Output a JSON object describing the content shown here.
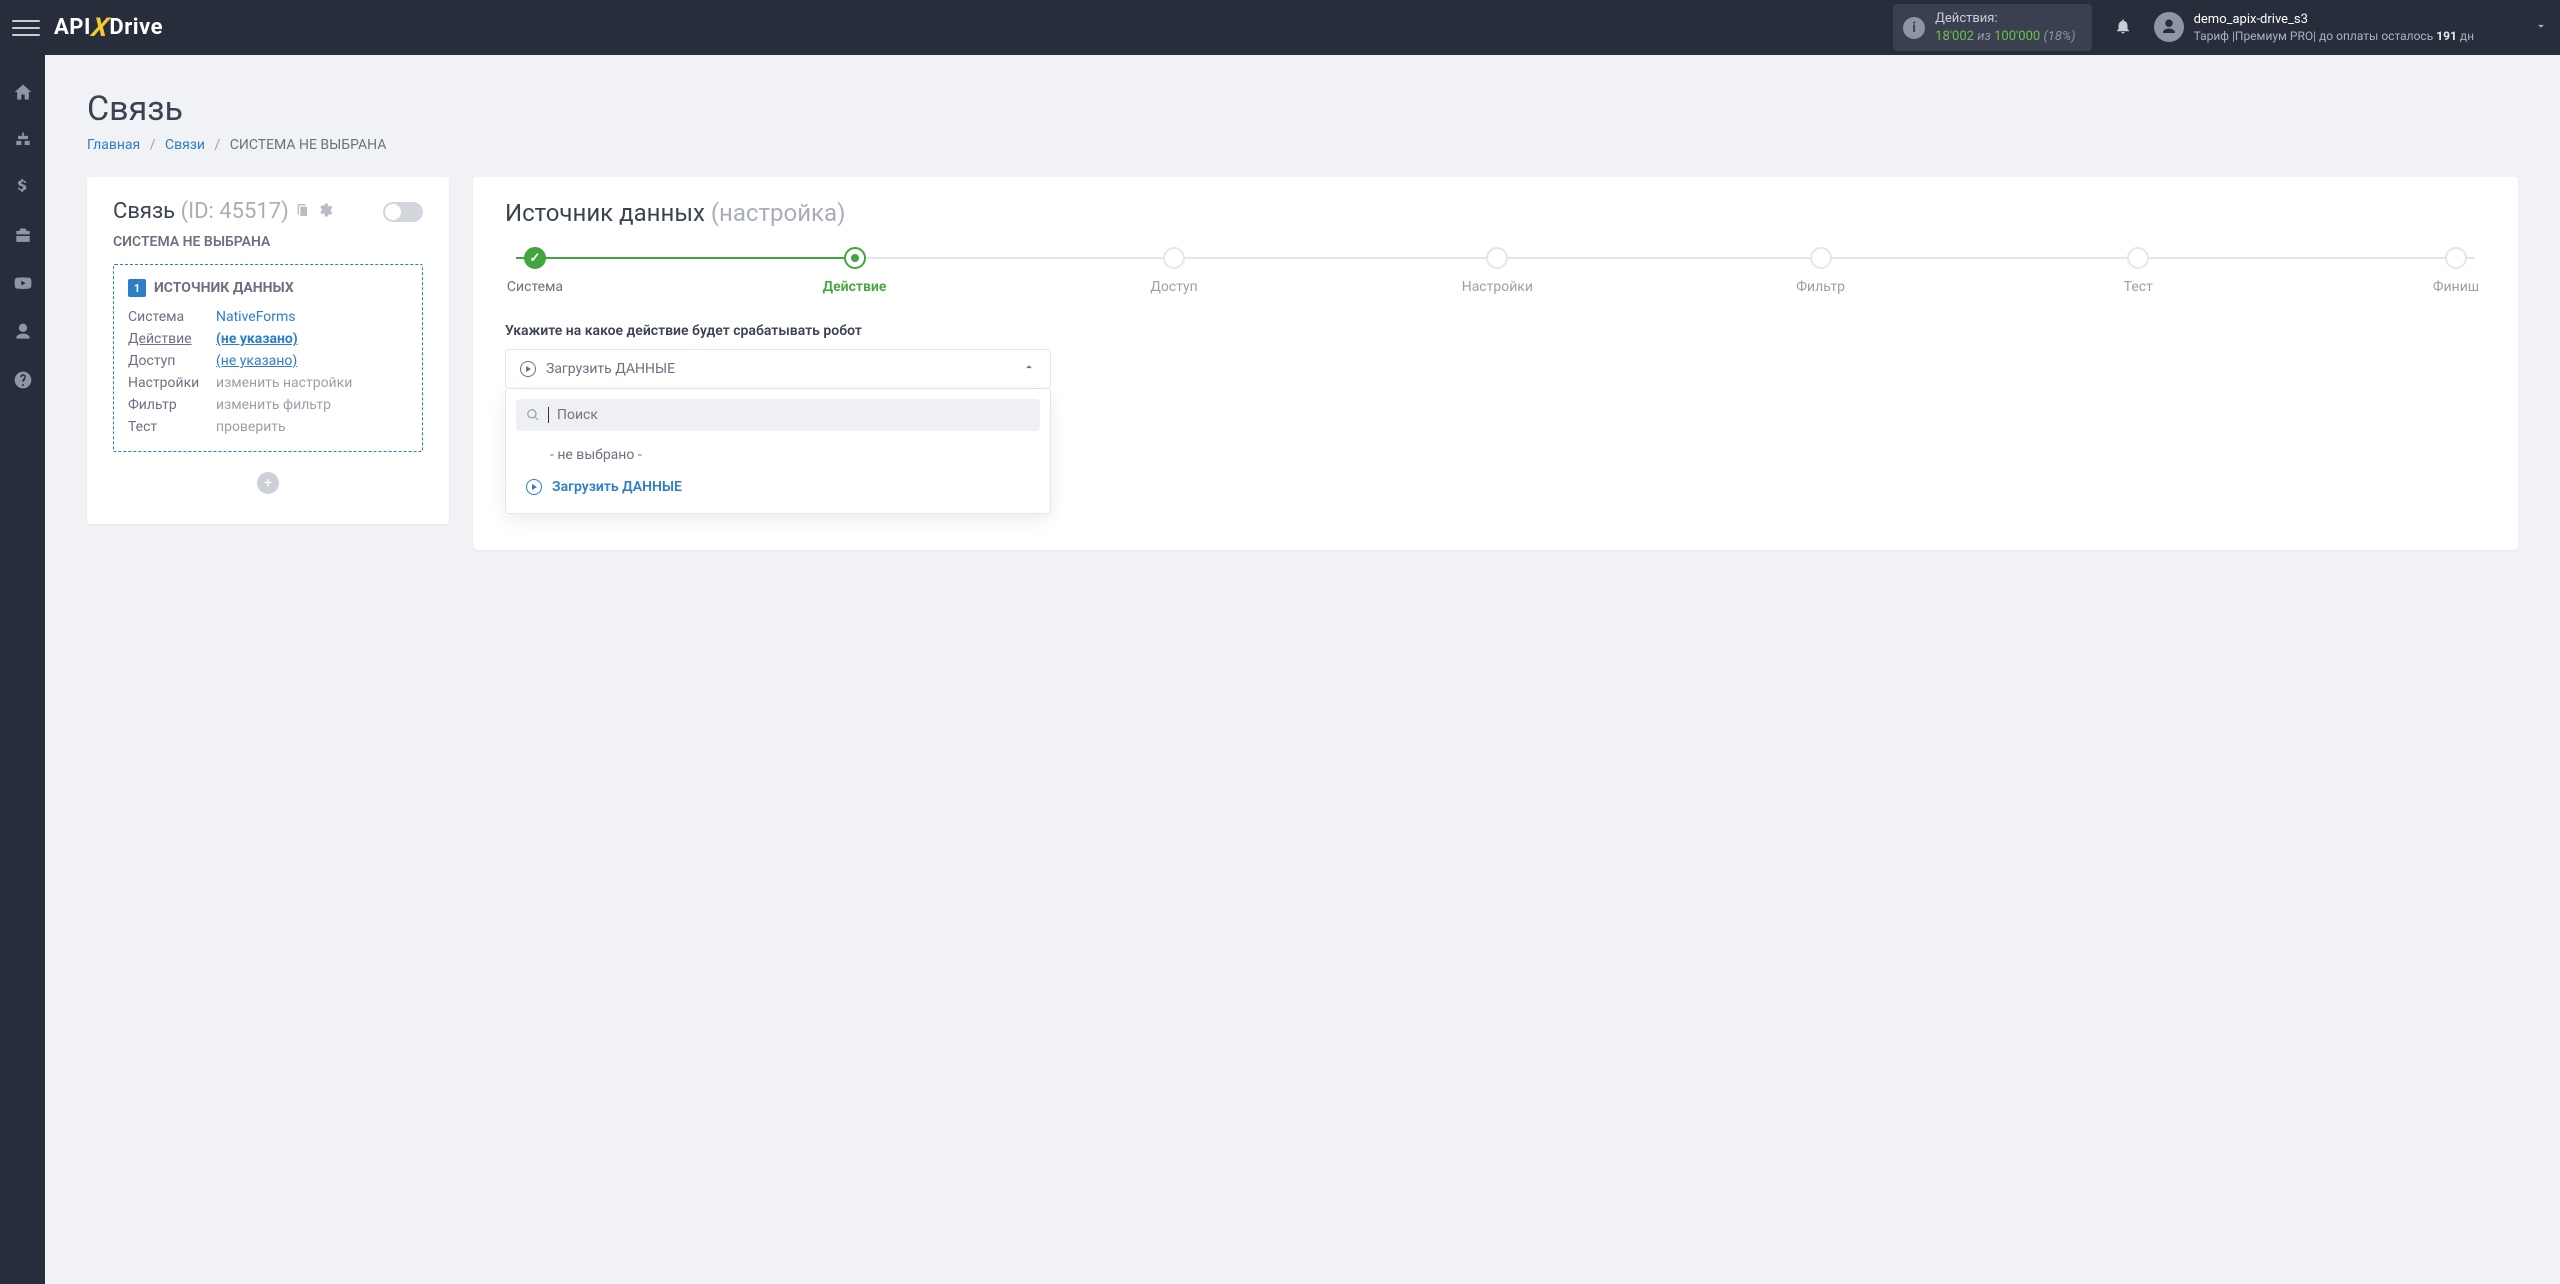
{
  "brand": {
    "left": "API",
    "right": "Drive"
  },
  "topbar": {
    "actions_label": "Действия:",
    "used": "18'002",
    "of": "из",
    "total": "100'000",
    "pct": "(18%)",
    "user": "demo_apix-drive_s3",
    "tariff_prefix": "Тариф |Премиум PRO|  до оплаты осталось ",
    "tariff_days": "191",
    "tariff_suffix": " дн"
  },
  "page": {
    "title": "Связь"
  },
  "breadcrumb": {
    "home": "Главная",
    "links": "Связи",
    "current": "СИСТЕМА НЕ ВЫБРАНА"
  },
  "leftcard": {
    "title_main": "Связь",
    "title_id": "(ID: 45517)",
    "subtitle": "СИСТЕМА НЕ ВЫБРАНА",
    "box_title": "ИСТОЧНИК ДАННЫХ",
    "box_num": "1",
    "rows": {
      "system_k": "Система",
      "system_v": "NativeForms",
      "action_k": "Действие",
      "action_v": "(не указано)",
      "access_k": "Доступ",
      "access_v": "(не указано)",
      "settings_k": "Настройки",
      "settings_v": "изменить настройки",
      "filter_k": "Фильтр",
      "filter_v": "изменить фильтр",
      "test_k": "Тест",
      "test_v": "проверить"
    }
  },
  "rightcard": {
    "title_main": "Источник данных",
    "title_sub": "(настройка)",
    "steps": [
      "Система",
      "Действие",
      "Доступ",
      "Настройки",
      "Фильтр",
      "Тест",
      "Финиш"
    ],
    "prompt": "Укажите на какое действие будет срабатывать робот",
    "dd_value": "Загрузить ДАННЫЕ",
    "search_placeholder": "Поиск",
    "opt_none": "- не выбрано -",
    "opt_load": "Загрузить ДАННЫЕ"
  }
}
